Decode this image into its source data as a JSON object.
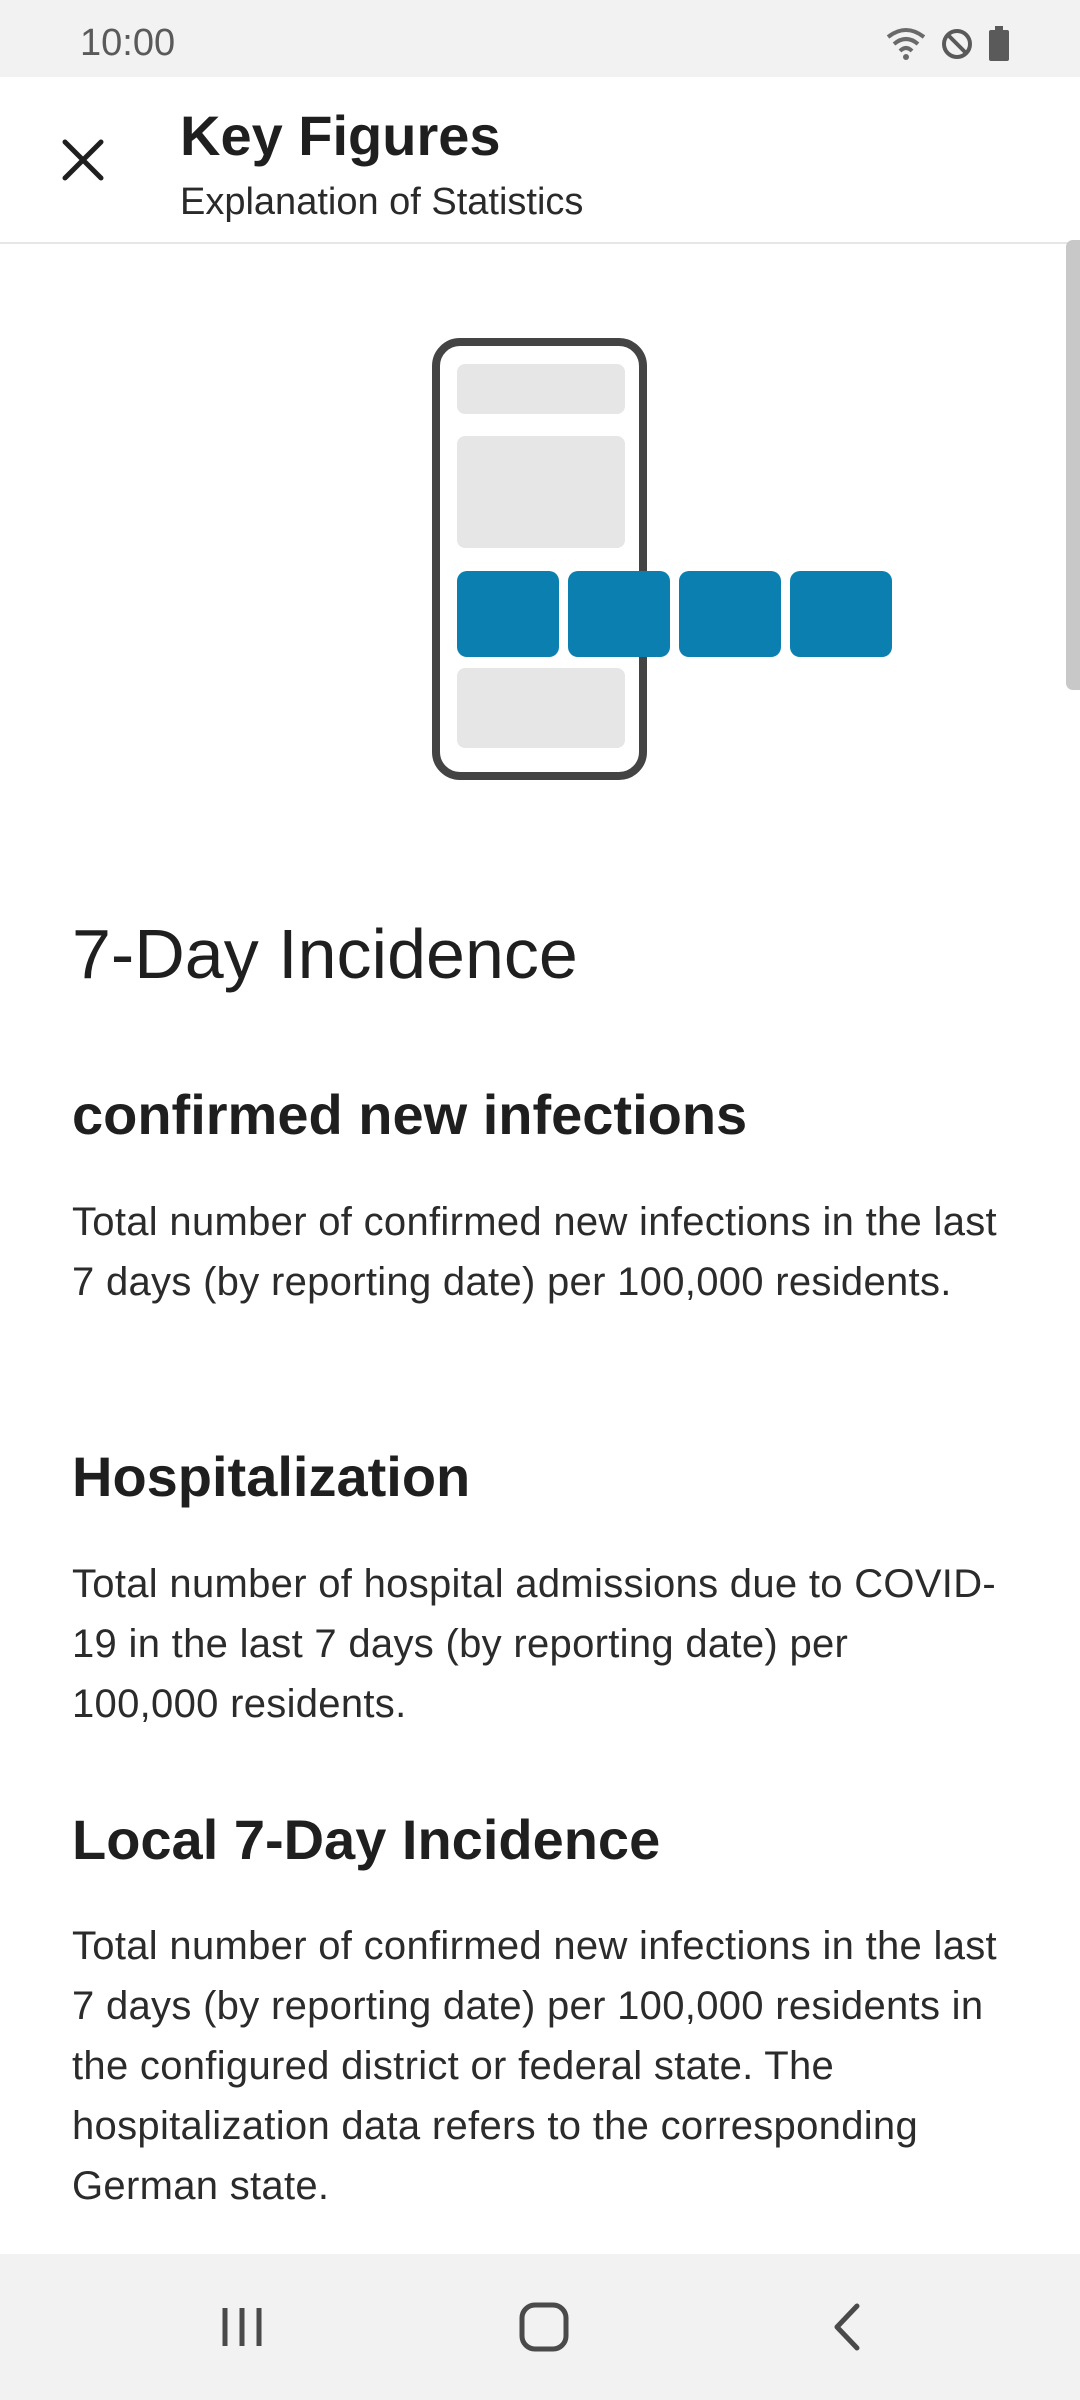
{
  "status_bar": {
    "time": "10:00",
    "icons": [
      "wifi-icon",
      "do-not-disturb-icon",
      "battery-icon"
    ]
  },
  "app_bar": {
    "title": "Key Figures",
    "subtitle": "Explanation of Statistics",
    "close_icon": "close-icon"
  },
  "illustration": {
    "accent_color": "#0a7fb0",
    "placeholder_color": "#e6e6e6",
    "frame_color": "#444444"
  },
  "content": {
    "main_title": "7-Day Incidence",
    "sections": [
      {
        "heading": "confirmed new infections",
        "body": "Total number of confirmed new infections in the last 7 days (by reporting date) per 100,000 residents."
      },
      {
        "heading": "Hospitalization",
        "body": "Total number of hospital admissions due to COVID-19 in the last 7 days (by reporting date) per 100,000 residents."
      },
      {
        "heading": "Local 7-Day Incidence",
        "body": "Total number of confirmed new infections in the last 7 days (by reporting date) per 100,000 residents in the configured district or federal state. The hospitalization data refers to the corresponding German state."
      }
    ]
  },
  "nav_bar": {
    "icons": [
      "recent-apps-icon",
      "home-icon",
      "back-icon"
    ]
  }
}
